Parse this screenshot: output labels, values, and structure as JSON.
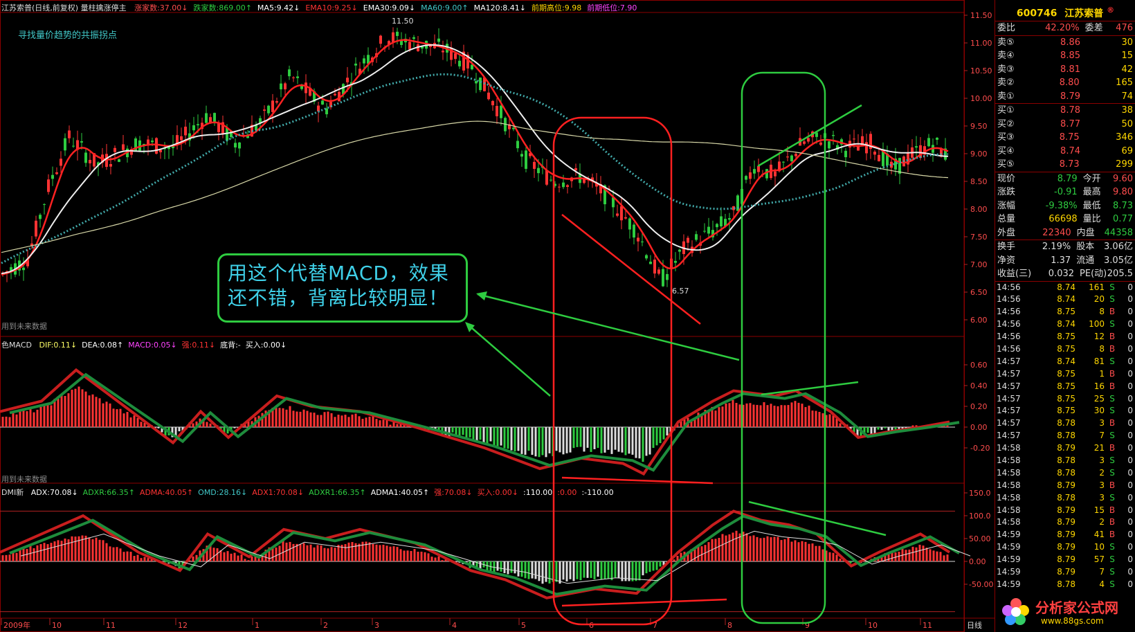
{
  "header": {
    "title": "江苏索普(日线,前复权) 量柱擒涨停主",
    "items": [
      {
        "label": "涨家数:37.00↓",
        "color": "#ff4d4d"
      },
      {
        "label": "跌家数:869.00↑",
        "color": "#2ecc40"
      },
      {
        "label": "MA5:9.42↓",
        "color": "#ffffff"
      },
      {
        "label": "EMA10:9.25↓",
        "color": "#ff3333"
      },
      {
        "label": "EMA30:9.09↓",
        "color": "#ffffff"
      },
      {
        "label": "MA60:9.00↑",
        "color": "#41c7c7"
      },
      {
        "label": "MA120:8.41↓",
        "color": "#ffffff"
      },
      {
        "label": "前期高位:9.98",
        "color": "#ffd700"
      },
      {
        "label": "前期低位:7.90",
        "color": "#ff44ff"
      }
    ]
  },
  "notes": {
    "main_note": "寻找量价趋势的共振拐点",
    "future_data_1": "用到未来数据",
    "future_data_2": "用到未来数据",
    "high_marker": "11.50",
    "low_marker": "6.57"
  },
  "macd_header": {
    "name": "色MACD",
    "items": [
      {
        "label": "DIF:0.11↓",
        "color": "#ffff66"
      },
      {
        "label": "DEA:0.08↑",
        "color": "#ffffff"
      },
      {
        "label": "MACD:0.05↓",
        "color": "#ff44ff"
      },
      {
        "label": "强:0.11↓",
        "color": "#ff3333"
      },
      {
        "label": "底背:-",
        "color": "#ffffff"
      },
      {
        "label": "买入:0.00↓",
        "color": "#ffffff"
      }
    ]
  },
  "dmi_header": {
    "name": "DMI新",
    "items": [
      {
        "label": "ADX:70.08↓",
        "color": "#ffffff"
      },
      {
        "label": "ADXR:66.35↑",
        "color": "#2ecc40"
      },
      {
        "label": "ADMA:40.05↑",
        "color": "#ff3333"
      },
      {
        "label": "OMD:28.16↓",
        "color": "#41c7c7"
      },
      {
        "label": "ADX1:70.08↓",
        "color": "#ff3333"
      },
      {
        "label": "ADXR1:66.35↑",
        "color": "#2ecc40"
      },
      {
        "label": "ADMA1:40.05↑",
        "color": "#ffffff"
      },
      {
        "label": "强:70.08↓",
        "color": "#ff3333"
      },
      {
        "label": "买入:0.00↓",
        "color": "#ff3333"
      },
      {
        "label": ":110.00",
        "color": "#ffffff"
      },
      {
        "label": ":0.00",
        "color": "#ff3333"
      },
      {
        "label": ":-110.00",
        "color": "#ffffff"
      }
    ]
  },
  "callout": {
    "line1": "用这个代替MACD，效果",
    "line2": "还不错，背离比较明显！"
  },
  "price_axis": [
    "11.50",
    "11.00",
    "10.50",
    "10.00",
    "9.50",
    "9.00",
    "8.50",
    "8.00",
    "7.50",
    "7.00",
    "6.50",
    "6.00"
  ],
  "macd_axis": [
    "0.60",
    "0.40",
    "0.20",
    "0.00",
    "-0.20"
  ],
  "dmi_axis": [
    "150.0",
    "100.0",
    "50.00",
    "0.00",
    "-50.00"
  ],
  "date_axis": [
    "2009年",
    "10",
    "11",
    "12",
    "1",
    "2",
    "3",
    "4",
    "5",
    "6",
    "7",
    "8",
    "9",
    "10",
    "11"
  ],
  "period_label": "日线",
  "quote": {
    "code": "600746",
    "name": "江苏索普",
    "committee": {
      "label1": "委比",
      "ratio": "42.20%",
      "label2": "委差",
      "diff": "476"
    },
    "asks": [
      {
        "label": "卖⑤",
        "price": "8.86",
        "vol": "30"
      },
      {
        "label": "卖④",
        "price": "8.85",
        "vol": "15"
      },
      {
        "label": "卖③",
        "price": "8.81",
        "vol": "42"
      },
      {
        "label": "卖②",
        "price": "8.80",
        "vol": "165"
      },
      {
        "label": "卖①",
        "price": "8.79",
        "vol": "74"
      }
    ],
    "bids": [
      {
        "label": "买①",
        "price": "8.78",
        "vol": "38"
      },
      {
        "label": "买②",
        "price": "8.77",
        "vol": "50"
      },
      {
        "label": "买③",
        "price": "8.75",
        "vol": "346"
      },
      {
        "label": "买④",
        "price": "8.74",
        "vol": "69"
      },
      {
        "label": "买⑤",
        "price": "8.73",
        "vol": "299"
      }
    ],
    "stats": [
      {
        "k1": "现价",
        "v1": "8.79",
        "c1": "#2ecc40",
        "k2": "今开",
        "v2": "9.60",
        "c2": "#ff4d4d"
      },
      {
        "k1": "涨跌",
        "v1": "-0.91",
        "c1": "#2ecc40",
        "k2": "最高",
        "v2": "9.80",
        "c2": "#ff4d4d"
      },
      {
        "k1": "涨幅",
        "v1": "-9.38%",
        "c1": "#2ecc40",
        "k2": "最低",
        "v2": "8.73",
        "c2": "#2ecc40"
      },
      {
        "k1": "总量",
        "v1": "66698",
        "c1": "#ffd700",
        "k2": "量比",
        "v2": "0.77",
        "c2": "#2ecc40"
      },
      {
        "k1": "外盘",
        "v1": "22340",
        "c1": "#ff4d4d",
        "k2": "内盘",
        "v2": "44358",
        "c2": "#2ecc40"
      }
    ],
    "fund": [
      {
        "k1": "换手",
        "v1": "2.19%",
        "k2": "股本",
        "v2": "3.06亿"
      },
      {
        "k1": "净资",
        "v1": "1.37",
        "k2": "流通",
        "v2": "3.05亿"
      },
      {
        "k1": "收益(三)",
        "v1": "0.032",
        "k2": "PE(动)",
        "v2": "205.5"
      }
    ],
    "ticks": [
      {
        "t": "14:56",
        "p": "8.74",
        "v": "161",
        "s": "S",
        "z": "0"
      },
      {
        "t": "14:56",
        "p": "8.74",
        "v": "20",
        "s": "S",
        "z": "0"
      },
      {
        "t": "14:56",
        "p": "8.75",
        "v": "8",
        "s": "B",
        "z": "0"
      },
      {
        "t": "14:56",
        "p": "8.74",
        "v": "100",
        "s": "S",
        "z": "0"
      },
      {
        "t": "14:56",
        "p": "8.75",
        "v": "12",
        "s": "B",
        "z": "0"
      },
      {
        "t": "14:56",
        "p": "8.75",
        "v": "8",
        "s": "B",
        "z": "0"
      },
      {
        "t": "14:57",
        "p": "8.74",
        "v": "81",
        "s": "S",
        "z": "0"
      },
      {
        "t": "14:57",
        "p": "8.75",
        "v": "1",
        "s": "B",
        "z": "0"
      },
      {
        "t": "14:57",
        "p": "8.75",
        "v": "16",
        "s": "B",
        "z": "0"
      },
      {
        "t": "14:57",
        "p": "8.75",
        "v": "25",
        "s": "S",
        "z": "0"
      },
      {
        "t": "14:57",
        "p": "8.75",
        "v": "30",
        "s": "S",
        "z": "0"
      },
      {
        "t": "14:57",
        "p": "8.78",
        "v": "3",
        "s": "B",
        "z": "0"
      },
      {
        "t": "14:57",
        "p": "8.78",
        "v": "7",
        "s": "S",
        "z": "0"
      },
      {
        "t": "14:58",
        "p": "8.79",
        "v": "21",
        "s": "B",
        "z": "0"
      },
      {
        "t": "14:58",
        "p": "8.78",
        "v": "3",
        "s": "S",
        "z": "0"
      },
      {
        "t": "14:58",
        "p": "8.78",
        "v": "2",
        "s": "S",
        "z": "0"
      },
      {
        "t": "14:58",
        "p": "8.79",
        "v": "3",
        "s": "B",
        "z": "0"
      },
      {
        "t": "14:58",
        "p": "8.78",
        "v": "3",
        "s": "S",
        "z": "0"
      },
      {
        "t": "14:58",
        "p": "8.79",
        "v": "15",
        "s": "B",
        "z": "0"
      },
      {
        "t": "14:58",
        "p": "8.79",
        "v": "2",
        "s": "B",
        "z": "0"
      },
      {
        "t": "14:59",
        "p": "8.79",
        "v": "41",
        "s": "B",
        "z": "0"
      },
      {
        "t": "14:59",
        "p": "8.79",
        "v": "10",
        "s": "S",
        "z": "0"
      },
      {
        "t": "14:59",
        "p": "8.79",
        "v": "57",
        "s": "S",
        "z": "0"
      },
      {
        "t": "14:59",
        "p": "8.79",
        "v": "7",
        "s": "S",
        "z": "0"
      },
      {
        "t": "14:59",
        "p": "8.78",
        "v": "4",
        "s": "S",
        "z": "0"
      }
    ]
  },
  "logo": {
    "text": "分析家公式网",
    "url": "www.88gs.com"
  },
  "colors": {
    "up": "#ff3333",
    "down": "#2ecc40",
    "frame": "#8b0000",
    "axis_text": "#ff4d4d"
  }
}
